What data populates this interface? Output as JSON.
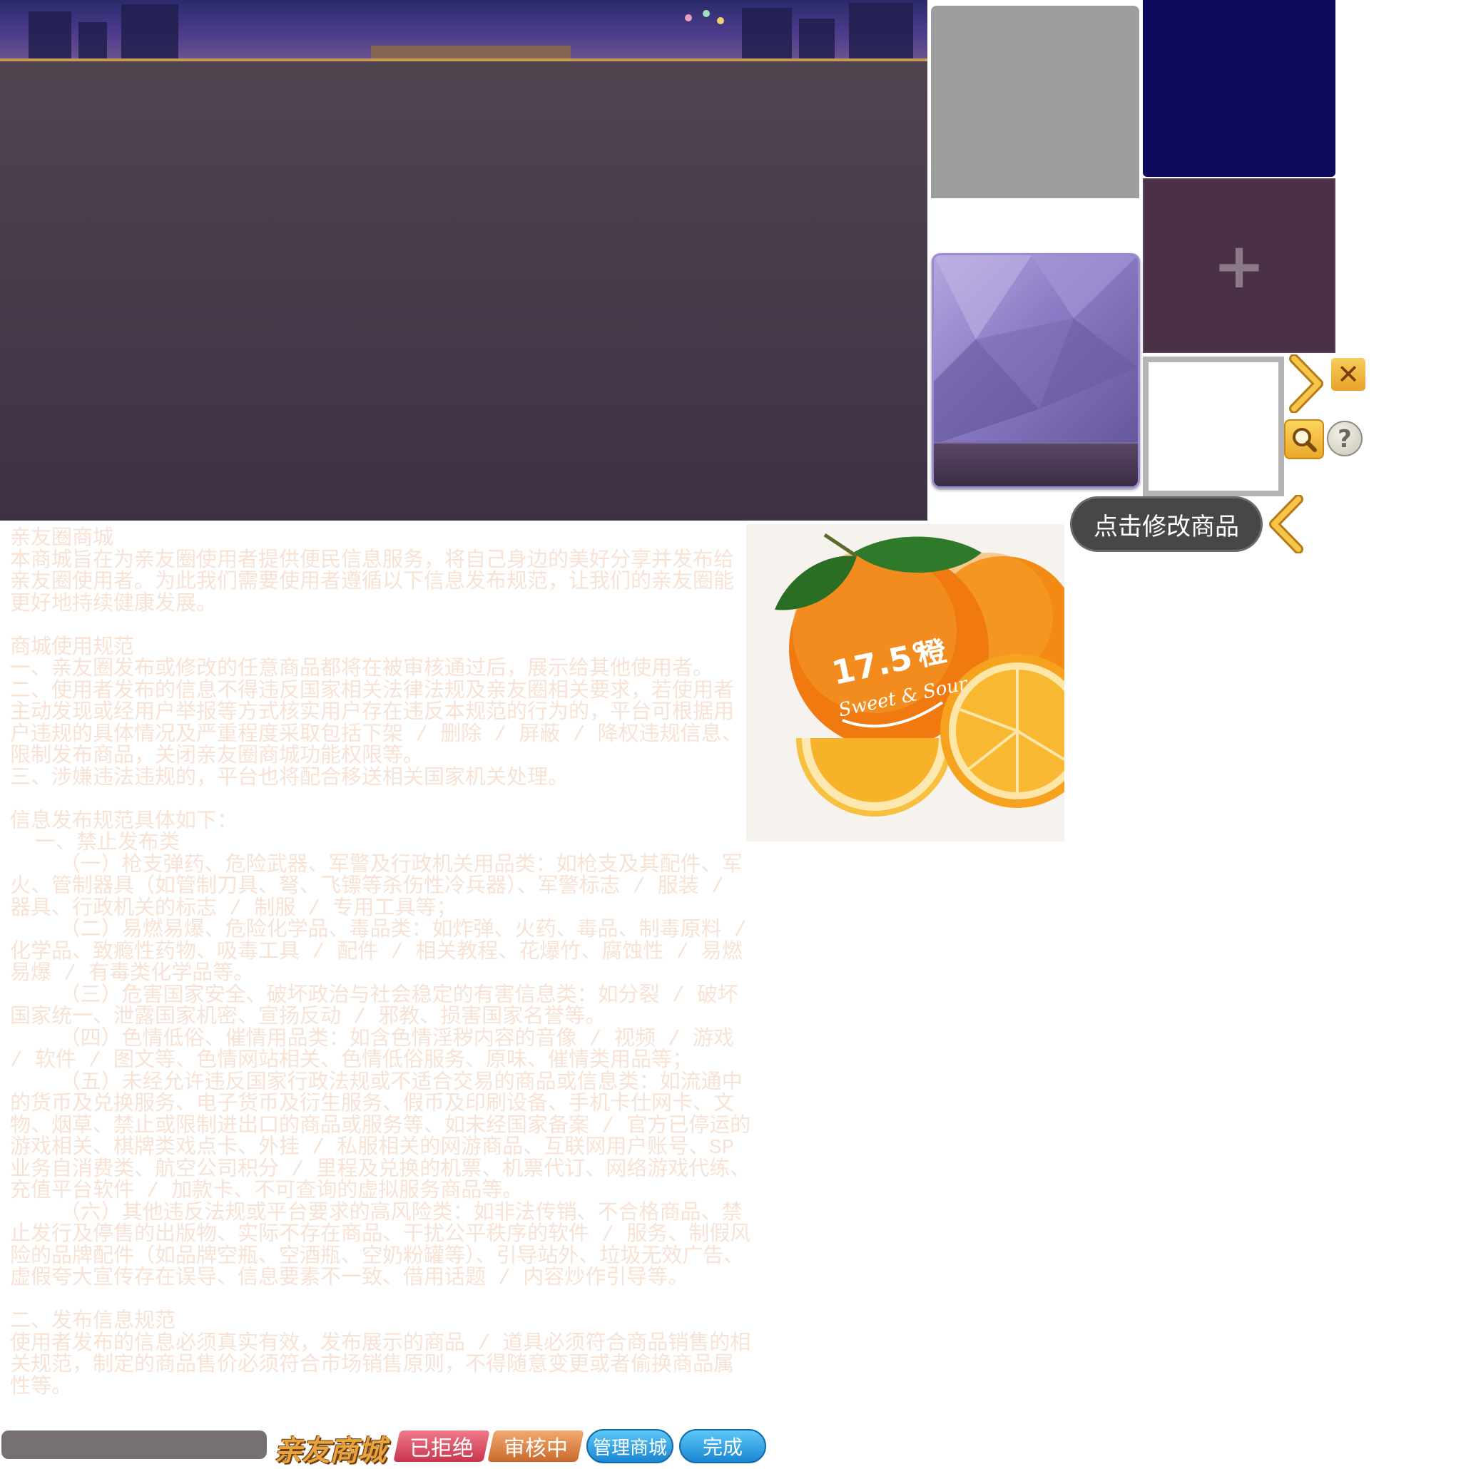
{
  "colors": {
    "panel": "#4a3f4c",
    "rules_text": "#f7e2d4",
    "tip_bg": "#474747",
    "gold_accent": "#f0b340",
    "button_blue": "#1a86d2",
    "tile_navy": "#0e0a5b"
  },
  "icons": {
    "plus": "+",
    "close": "✕",
    "help": "?",
    "search": "search-icon",
    "chevron_right": "chevron-right-icon",
    "chevron_left": "chevron-left-icon"
  },
  "tooltip": {
    "edit_label": "点击修改商品"
  },
  "rules": {
    "body": "亲友圈商城\n本商城旨在为亲友圈使用者提供便民信息服务，将自己身边的美好分享并发布给亲友圈使用者。为此我们需要使用者遵循以下信息发布规范，让我们的亲友圈能更好地持续健康发展。\n\n商城使用规范\n一、亲友圈发布或修改的任意商品都将在被审核通过后，展示给其他使用者。\n二、使用者发布的信息不得违反国家相关法律法规及亲友圈相关要求，若使用者主动发现或经用户举报等方式核实用户存在违反本规范的行为的，平台可根据用户违规的具体情况及严重程度采取包括下架 / 删除 / 屏蔽 / 降权违规信息、限制发布商品，关闭亲友圈商城功能权限等。\n三、涉嫌违法违规的，平台也将配合移送相关国家机关处理。\n\n信息发布规范具体如下：\n  一、禁止发布类\n    （一）枪支弹药、危险武器、军警及行政机关用品类：如枪支及其配件、军火、管制器具（如管制刀具、弩、飞镖等杀伤性冷兵器）、军警标志 / 服装 / 器具、行政机关的标志 / 制服 / 专用工具等；\n    （二）易燃易爆、危险化学品、毒品类：如炸弹、火药、毒品、制毒原料 / 化学品、致瘾性药物、吸毒工具 / 配件 / 相关教程、花爆竹、腐蚀性 / 易燃易爆 / 有毒类化学品等。\n    （三）危害国家安全、破坏政治与社会稳定的有害信息类：如分裂 / 破坏国家统一、泄露国家机密、宣扬反动 / 邪教、损害国家名誉等。\n    （四）色情低俗、催情用品类：如含色情淫秽内容的音像 / 视频 / 游戏 / 软件 / 图文等、色情网站相关、色情低俗服务、原味、催情类用品等；\n    （五）未经允许违反国家行政法规或不适合交易的商品或信息类：如流通中的货币及兑换服务、电子货币及衍生服务、假币及印刷设备、手机卡仕网卡、文物、烟草、禁止或限制进出口的商品或服务等、如未经国家备案 / 官方已停运的游戏相关、棋牌类戏点卡、外挂 / 私服相关的网游商品、互联网用户账号、SP 业务自消费类、航空公司积分 / 里程及兑换的机票、机票代订、网络游戏代练、充值平台软件 / 加款卡、不可查询的虚拟服务商品等。\n    （六）其他违反法规或平台要求的高风险类：如非法传销、不合格商品、禁止发行及停售的出版物、实际不存在商品、干扰公平秩序的软件 / 服务、制假风险的品牌配件（如品牌空瓶、空酒瓶、空奶粉罐等）、引导站外、垃圾无效广告、虚假夸大宣传存在误导、信息要素不一致、借用话题 / 内容炒作引导等。\n\n二、发布信息规范\n使用者发布的信息必须真实有效，发布展示的商品 / 道具必须符合商品销售的相关规范，制定的商品售价必须符合市场销售原则，不得随意变更或者偷换商品属性等。"
  },
  "product_image": {
    "badge_number": "17.5°",
    "badge_char": "橙",
    "badge_sub": "Sweet & Sour"
  },
  "buttons": {
    "shop_title": "亲友商城",
    "rejected": "已拒绝",
    "in_review": "审核中",
    "manage_shop": "管理商城",
    "done": "完成"
  }
}
